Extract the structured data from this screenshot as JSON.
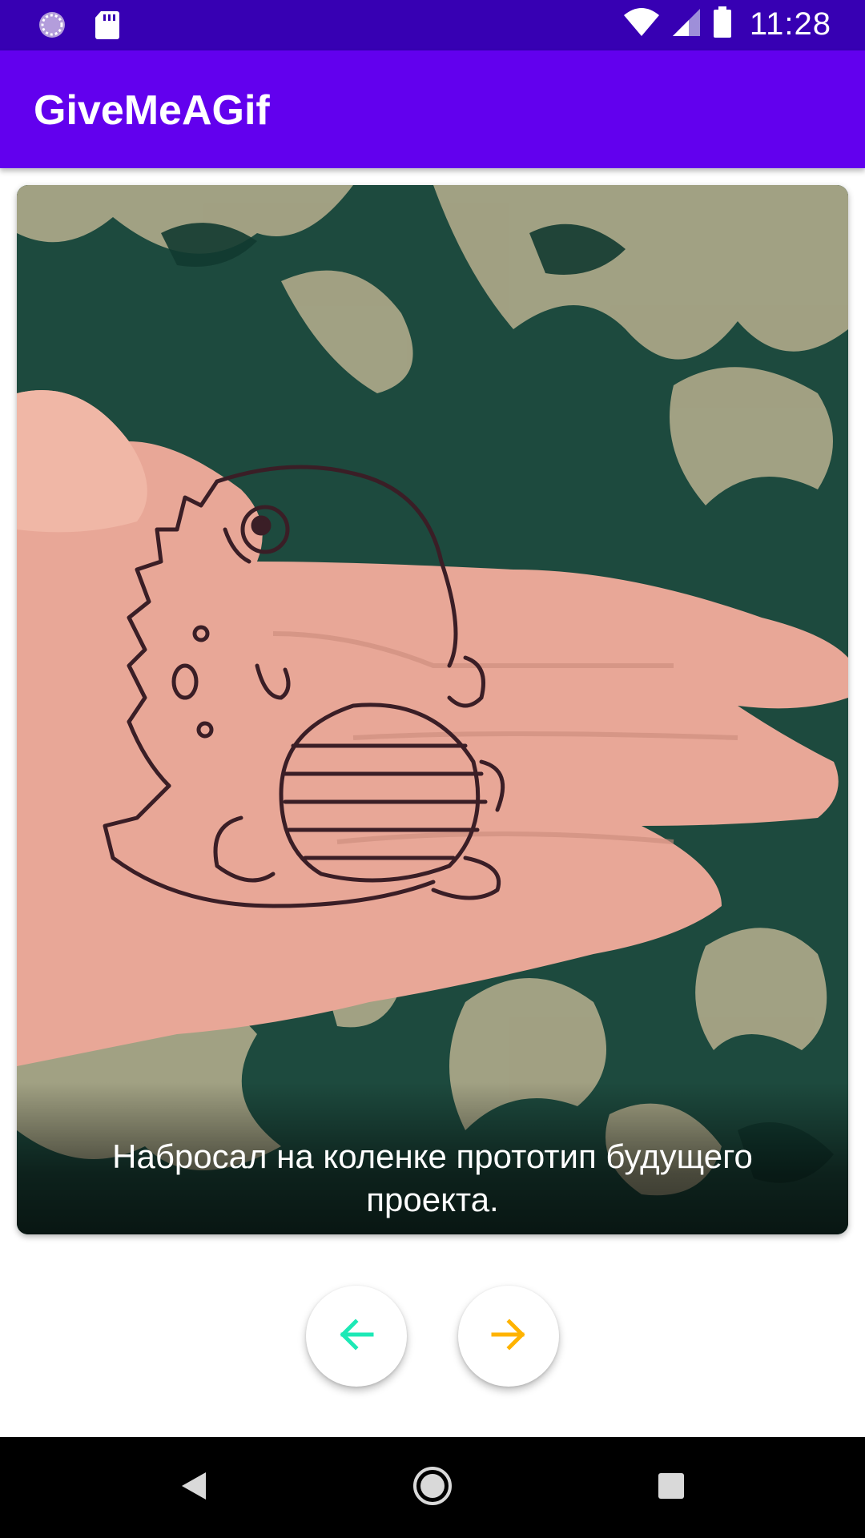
{
  "status_bar": {
    "time": "11:28",
    "icons": [
      "loading-icon",
      "sd-card-icon",
      "wifi-icon",
      "cell-signal-icon",
      "battery-icon"
    ]
  },
  "app_bar": {
    "title": "GiveMeAGif"
  },
  "gif": {
    "caption": "Набросал на коленке прототип будущего проекта."
  },
  "controls": {
    "back_icon": "arrow-left-icon",
    "forward_icon": "arrow-right-icon",
    "back_color": "#1de9b6",
    "forward_color": "#ffb300"
  },
  "system_nav": {
    "icons": [
      "back-triangle-icon",
      "home-circle-icon",
      "recents-square-icon"
    ]
  },
  "colors": {
    "status_bar": "#3700b3",
    "app_bar": "#6200ee"
  }
}
